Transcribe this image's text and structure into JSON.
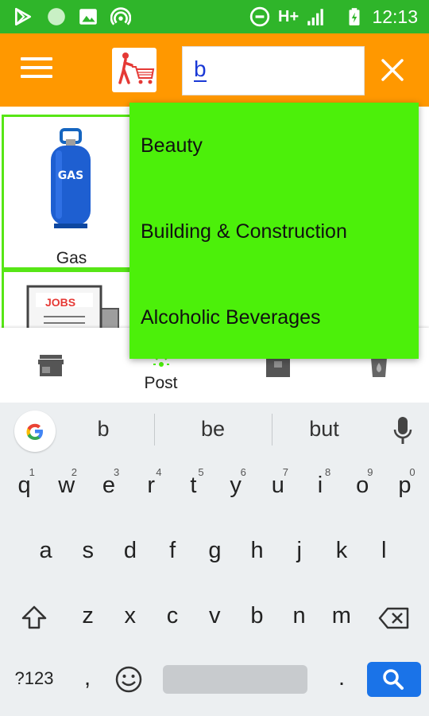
{
  "status_bar": {
    "time": "12:13",
    "network": "H+",
    "icons": [
      "play-store-icon",
      "circle-icon",
      "image-icon",
      "hotspot-icon",
      "do-not-disturb-icon",
      "signal-icon",
      "battery-icon"
    ]
  },
  "app_bar": {
    "search_value": "b",
    "colors": {
      "bar": "#ff9800",
      "status": "#2fb52a"
    }
  },
  "categories": {
    "gas_label": "Gas",
    "jobs_sign": "JOBS"
  },
  "bottom_nav": {
    "post_label": "Post"
  },
  "dropdown": {
    "items": [
      "Beauty",
      "Building & Construction",
      "Alcoholic Beverages"
    ],
    "color": "#4cf00a"
  },
  "keyboard": {
    "suggestions": [
      "b",
      "be",
      "but"
    ],
    "row1": [
      "q",
      "w",
      "e",
      "r",
      "t",
      "y",
      "u",
      "i",
      "o",
      "p"
    ],
    "row1_hints": [
      "1",
      "2",
      "3",
      "4",
      "5",
      "6",
      "7",
      "8",
      "9",
      "0"
    ],
    "row2": [
      "a",
      "s",
      "d",
      "f",
      "g",
      "h",
      "j",
      "k",
      "l"
    ],
    "row3": [
      "z",
      "x",
      "c",
      "v",
      "b",
      "n",
      "m"
    ],
    "symbols_label": "?123",
    "comma": ",",
    "period": "."
  }
}
